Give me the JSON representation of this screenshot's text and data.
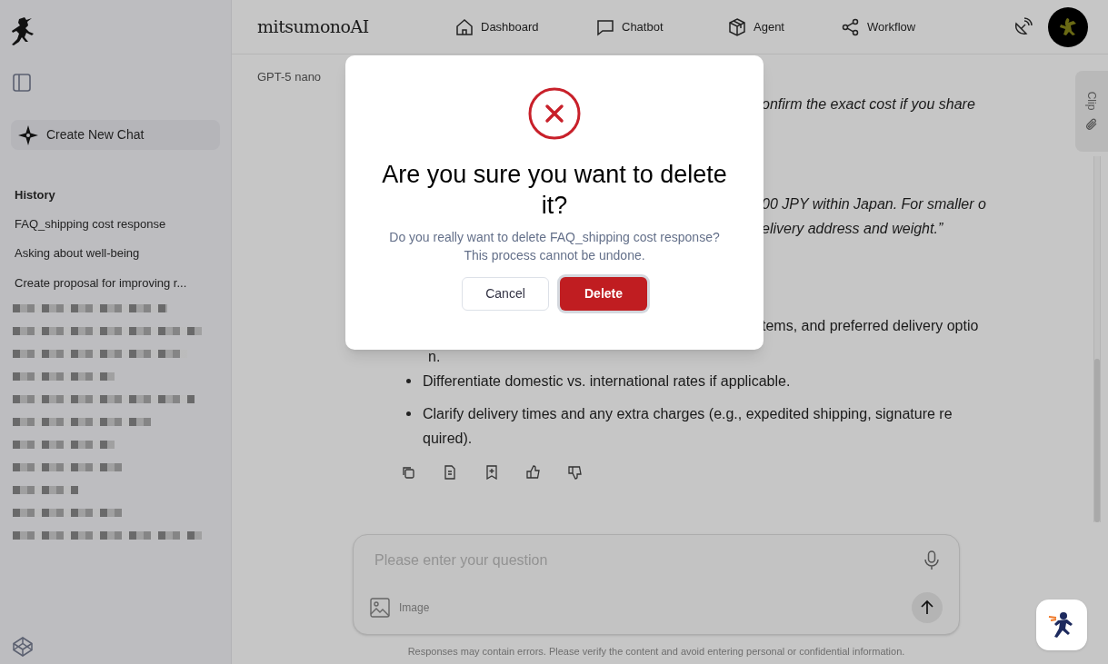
{
  "sidebar": {
    "new_chat_button": "Create New Chat",
    "history_heading": "History",
    "history_items": [
      {
        "title": "FAQ_shipping cost response"
      },
      {
        "title": "Asking about well-being"
      },
      {
        "title": "Create proposal for improving r..."
      }
    ]
  },
  "header": {
    "brand": "mitsumonoAI",
    "nav": [
      {
        "label": "Dashboard",
        "kind": "home"
      },
      {
        "label": "Chatbot",
        "kind": "chat"
      },
      {
        "label": "Agent",
        "kind": "box"
      },
      {
        "label": "Workflow",
        "kind": "share"
      }
    ]
  },
  "chat": {
    "model": "GPT-5 nano",
    "fragments": [
      {
        "text": "onfirm the exact cost if you share",
        "italic": true
      },
      {
        "text": "00 JPY within Japan. For smaller o",
        "italic": true
      },
      {
        "text": "elivery address and weight.”",
        "italic": true
      },
      {
        "text": "tems, and preferred delivery optio",
        "italic": false
      }
    ],
    "wrap_tail": "n.",
    "bullets": [
      {
        "lines": [
          "Differentiate domestic vs. international rates if applicable."
        ]
      },
      {
        "lines": [
          "Clarify delivery times and any extra charges (e.g., expedited shipping, signature re",
          "quired)."
        ]
      }
    ],
    "actions": [
      {
        "kind": "copy"
      },
      {
        "kind": "document"
      },
      {
        "kind": "bookmark"
      },
      {
        "kind": "like"
      },
      {
        "kind": "dislike"
      }
    ]
  },
  "composer": {
    "placeholder": "Please enter your question",
    "image_label": "Image",
    "disclaimer": "Responses may contain errors. Please verify the content and avoid entering personal or confidential information."
  },
  "clip_tab": {
    "label": "Clip"
  },
  "dialog": {
    "title": "Are you sure you want to delete it?",
    "message": "Do you really want to delete FAQ_shipping cost response? This process cannot be undone.",
    "buttons": [
      {
        "label": "Cancel",
        "kind": "secondary"
      },
      {
        "label": "Delete",
        "kind": "danger"
      }
    ]
  }
}
